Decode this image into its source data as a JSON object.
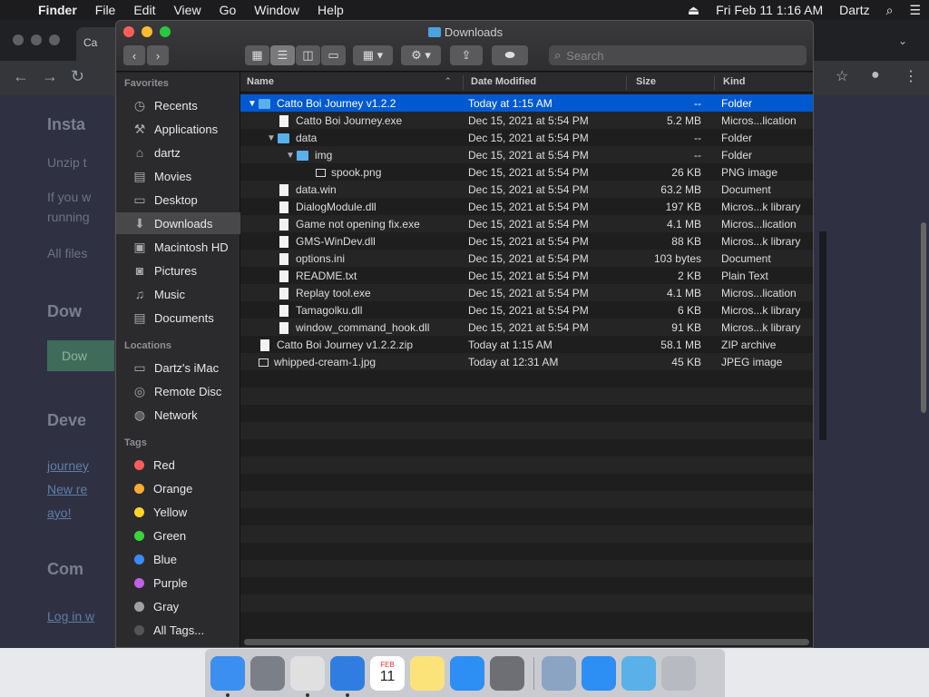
{
  "menubar": {
    "app_name": "Finder",
    "items": [
      "File",
      "Edit",
      "View",
      "Go",
      "Window",
      "Help"
    ],
    "eject_glyph": "⏏",
    "datetime": "Fri Feb 11  1:16 AM",
    "user": "Dartz",
    "search_glyph": "⌕",
    "menu_glyph": "☰"
  },
  "browser": {
    "tab_label": "Ca",
    "background_text": {
      "heading1": "Insta",
      "p1": "Unzip t",
      "p2a": "If you w",
      "p2b": "running",
      "p3": "All files",
      "heading2": "Dow",
      "button": "Dow",
      "heading3": "Deve",
      "link1": "journey",
      "link2": "New re",
      "link3": "ayo!",
      "heading4": "Com",
      "link4": "Log in w"
    }
  },
  "window": {
    "title": "Downloads",
    "search_placeholder": "Search",
    "colors": {
      "selection": "#0059d1",
      "folder": "#5ab0e8"
    }
  },
  "sidebar": {
    "sections": [
      {
        "title": "Favorites",
        "items": [
          {
            "label": "Recents",
            "icon": "clock-icon"
          },
          {
            "label": "Applications",
            "icon": "applications-icon"
          },
          {
            "label": "dartz",
            "icon": "home-icon"
          },
          {
            "label": "Movies",
            "icon": "film-icon"
          },
          {
            "label": "Desktop",
            "icon": "desktop-icon"
          },
          {
            "label": "Downloads",
            "icon": "download-icon",
            "selected": true
          },
          {
            "label": "Macintosh HD",
            "icon": "disk-icon"
          },
          {
            "label": "Pictures",
            "icon": "camera-icon"
          },
          {
            "label": "Music",
            "icon": "music-icon"
          },
          {
            "label": "Documents",
            "icon": "document-icon"
          }
        ]
      },
      {
        "title": "Locations",
        "items": [
          {
            "label": "Dartz's iMac",
            "icon": "imac-icon"
          },
          {
            "label": "Remote Disc",
            "icon": "disc-icon"
          },
          {
            "label": "Network",
            "icon": "globe-icon"
          }
        ]
      },
      {
        "title": "Tags",
        "items": [
          {
            "label": "Red",
            "color": "#ff5b5b"
          },
          {
            "label": "Orange",
            "color": "#ffaa33"
          },
          {
            "label": "Yellow",
            "color": "#ffd426"
          },
          {
            "label": "Green",
            "color": "#3cd43c"
          },
          {
            "label": "Blue",
            "color": "#3a8bff"
          },
          {
            "label": "Purple",
            "color": "#c061e8"
          },
          {
            "label": "Gray",
            "color": "#a0a0a0"
          },
          {
            "label": "All Tags...",
            "color": "#555"
          }
        ]
      }
    ]
  },
  "columns": {
    "name": "Name",
    "date": "Date Modified",
    "size": "Size",
    "kind": "Kind"
  },
  "files": [
    {
      "name": "Catto Boi Journey v1.2.2",
      "date": "Today at 1:15 AM",
      "size": "--",
      "kind": "Folder",
      "level": 0,
      "type": "folder",
      "expanded": true,
      "selected": true
    },
    {
      "name": "Catto Boi Journey.exe",
      "date": "Dec 15, 2021 at 5:54 PM",
      "size": "5.2 MB",
      "kind": "Micros...lication",
      "level": 1,
      "type": "doc"
    },
    {
      "name": "data",
      "date": "Dec 15, 2021 at 5:54 PM",
      "size": "--",
      "kind": "Folder",
      "level": 1,
      "type": "folder",
      "expanded": true
    },
    {
      "name": "img",
      "date": "Dec 15, 2021 at 5:54 PM",
      "size": "--",
      "kind": "Folder",
      "level": 2,
      "type": "folder",
      "expanded": true
    },
    {
      "name": "spook.png",
      "date": "Dec 15, 2021 at 5:54 PM",
      "size": "26 KB",
      "kind": "PNG image",
      "level": 3,
      "type": "img"
    },
    {
      "name": "data.win",
      "date": "Dec 15, 2021 at 5:54 PM",
      "size": "63.2 MB",
      "kind": "Document",
      "level": 1,
      "type": "doc"
    },
    {
      "name": "DialogModule.dll",
      "date": "Dec 15, 2021 at 5:54 PM",
      "size": "197 KB",
      "kind": "Micros...k library",
      "level": 1,
      "type": "doc"
    },
    {
      "name": "Game not opening fix.exe",
      "date": "Dec 15, 2021 at 5:54 PM",
      "size": "4.1 MB",
      "kind": "Micros...lication",
      "level": 1,
      "type": "doc"
    },
    {
      "name": "GMS-WinDev.dll",
      "date": "Dec 15, 2021 at 5:54 PM",
      "size": "88 KB",
      "kind": "Micros...k library",
      "level": 1,
      "type": "doc"
    },
    {
      "name": "options.ini",
      "date": "Dec 15, 2021 at 5:54 PM",
      "size": "103 bytes",
      "kind": "Document",
      "level": 1,
      "type": "doc"
    },
    {
      "name": "README.txt",
      "date": "Dec 15, 2021 at 5:54 PM",
      "size": "2 KB",
      "kind": "Plain Text",
      "level": 1,
      "type": "doc"
    },
    {
      "name": "Replay tool.exe",
      "date": "Dec 15, 2021 at 5:54 PM",
      "size": "4.1 MB",
      "kind": "Micros...lication",
      "level": 1,
      "type": "doc"
    },
    {
      "name": "Tamagolku.dll",
      "date": "Dec 15, 2021 at 5:54 PM",
      "size": "6 KB",
      "kind": "Micros...k library",
      "level": 1,
      "type": "doc"
    },
    {
      "name": "window_command_hook.dll",
      "date": "Dec 15, 2021 at 5:54 PM",
      "size": "91 KB",
      "kind": "Micros...k library",
      "level": 1,
      "type": "doc"
    },
    {
      "name": "Catto Boi Journey v1.2.2.zip",
      "date": "Today at 1:15 AM",
      "size": "58.1 MB",
      "kind": "ZIP archive",
      "level": 0,
      "type": "doc"
    },
    {
      "name": "whipped-cream-1.jpg",
      "date": "Today at 12:31 AM",
      "size": "45 KB",
      "kind": "JPEG image",
      "level": 0,
      "type": "img"
    }
  ],
  "dock": {
    "items": [
      {
        "icon": "finder-icon",
        "color": "#3b8ff0",
        "running": true
      },
      {
        "icon": "launchpad-icon",
        "color": "#7a7f88"
      },
      {
        "icon": "chrome-icon",
        "color": "#e0e0e0",
        "running": true
      },
      {
        "icon": "safari-icon",
        "color": "#2f7de1",
        "running": true
      },
      {
        "icon": "calendar-icon",
        "color": "#ffffff",
        "glyph_month": "FEB",
        "glyph_day": "11"
      },
      {
        "icon": "notes-icon",
        "color": "#fbe37a"
      },
      {
        "icon": "app-store-icon",
        "color": "#2d8ef4"
      },
      {
        "icon": "system-preferences-icon",
        "color": "#6d6f74"
      },
      {
        "icon": "preview-icon",
        "color": "#8ba4c4"
      },
      {
        "icon": "applications-folder-icon",
        "color": "#2d8ef4"
      },
      {
        "icon": "downloads-folder-icon",
        "color": "#5ab0e8"
      },
      {
        "icon": "trash-icon",
        "color": "#b7bac0"
      }
    ]
  }
}
